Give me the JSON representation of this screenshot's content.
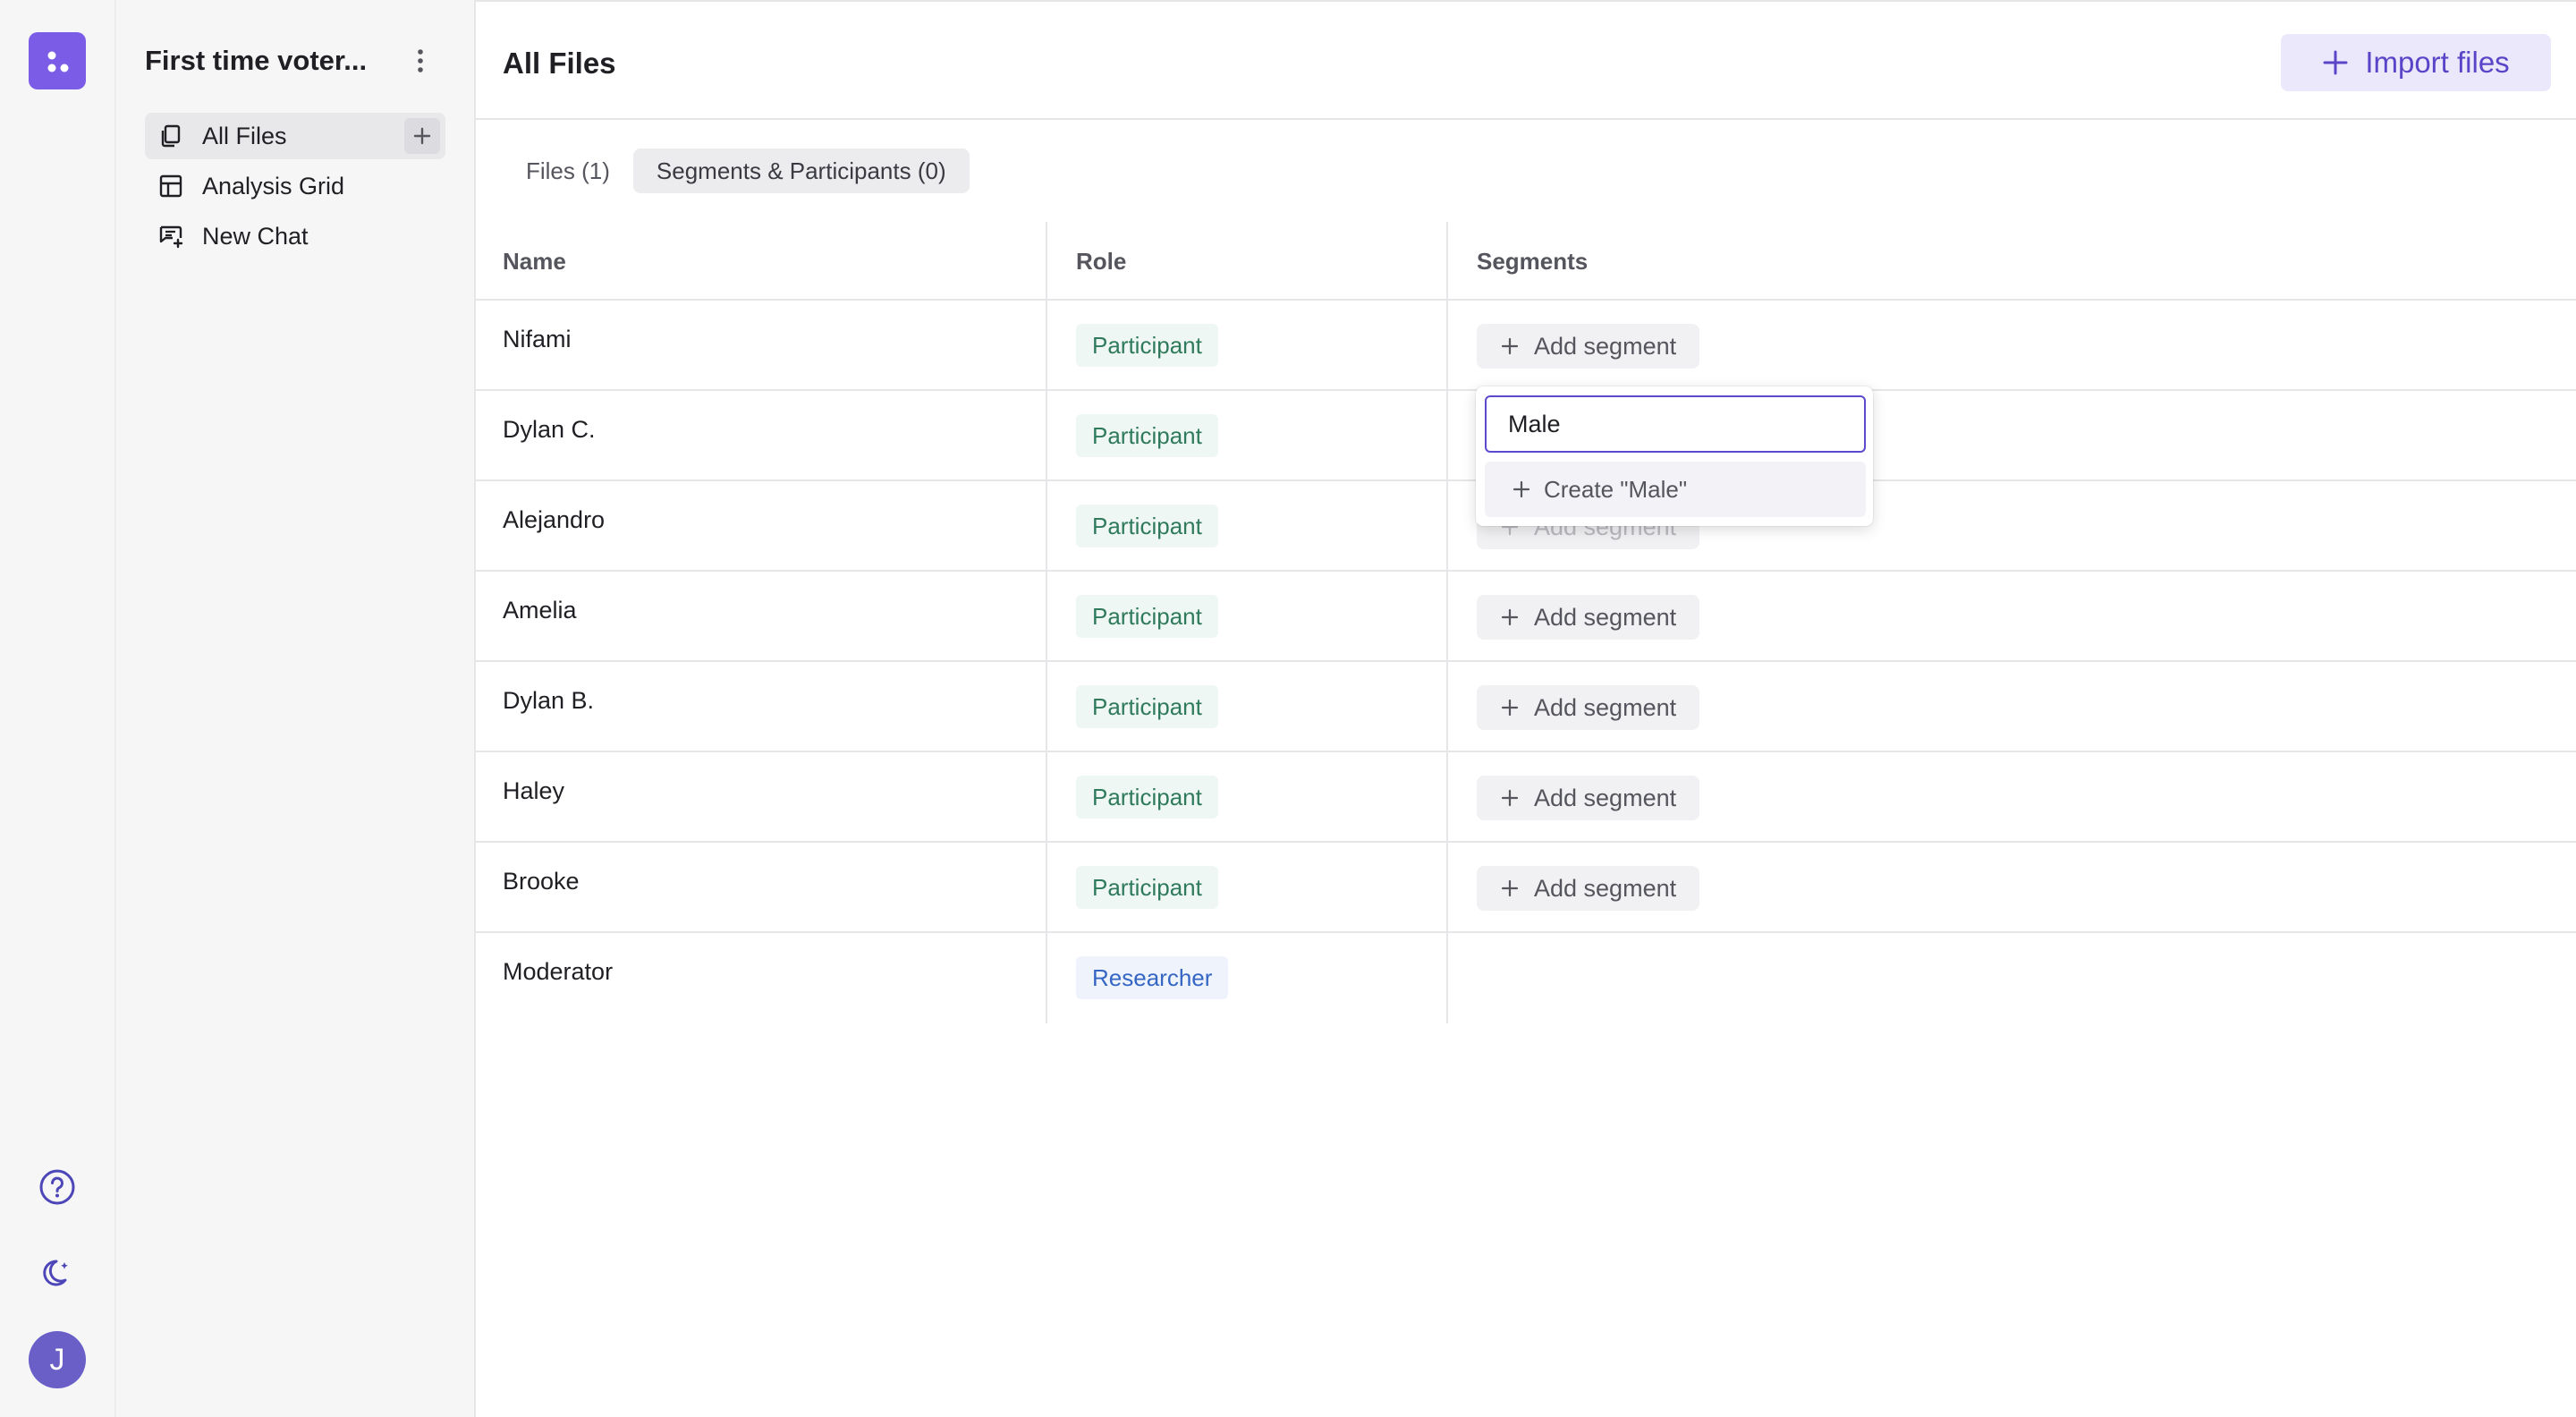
{
  "sidebar": {
    "project_title": "First time voter...",
    "items": [
      {
        "label": "All Files",
        "icon": "files-icon",
        "active": true
      },
      {
        "label": "Analysis Grid",
        "icon": "grid-icon",
        "active": false
      },
      {
        "label": "New Chat",
        "icon": "chat-icon",
        "active": false
      }
    ]
  },
  "rail": {
    "avatar_initial": "J"
  },
  "header": {
    "title": "All Files",
    "import_label": "Import files"
  },
  "tabs": [
    {
      "label": "Files (1)",
      "active": false
    },
    {
      "label": "Segments & Participants (0)",
      "active": true
    }
  ],
  "table": {
    "columns": [
      "Name",
      "Role",
      "Segments"
    ],
    "add_segment_label": "Add segment",
    "rows": [
      {
        "name": "Nifami",
        "role": "Participant"
      },
      {
        "name": "Dylan C.",
        "role": "Participant"
      },
      {
        "name": "Alejandro",
        "role": "Participant"
      },
      {
        "name": "Amelia",
        "role": "Participant"
      },
      {
        "name": "Dylan B.",
        "role": "Participant"
      },
      {
        "name": "Haley",
        "role": "Participant"
      },
      {
        "name": "Brooke",
        "role": "Participant"
      },
      {
        "name": "Moderator",
        "role": "Researcher"
      }
    ]
  },
  "segment_popover": {
    "input_value": "Male",
    "create_label": "Create \"Male\""
  },
  "colors": {
    "accent": "#5b49cf",
    "logo": "#7b5ce6",
    "participant": "#2f7a5c",
    "researcher": "#3566c4"
  }
}
